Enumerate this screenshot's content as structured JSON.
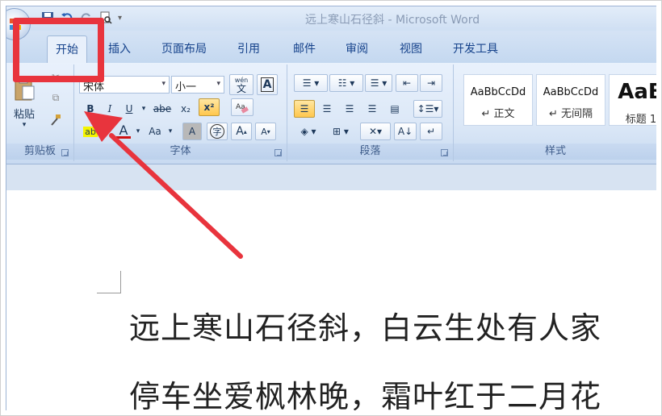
{
  "window": {
    "title": "远上寒山石径斜 - Microsoft Word"
  },
  "tabs": [
    "开始",
    "插入",
    "页面布局",
    "引用",
    "邮件",
    "审阅",
    "视图",
    "开发工具"
  ],
  "clipboard": {
    "paste_label": "粘贴",
    "group_label": "剪贴板"
  },
  "font": {
    "font_name": "宋体",
    "font_size": "小一",
    "group_label": "字体",
    "phonetic_label": "wén",
    "phonetic_char": "文",
    "bold": "B",
    "italic": "I",
    "underline": "U",
    "strike": "abe",
    "subscript": "x₂",
    "superscript": "x²",
    "highlight": "ab",
    "font_color": "A",
    "change_case": "Aa",
    "char_shading": "A",
    "enclose": "字",
    "grow": "A",
    "shrink": "A"
  },
  "paragraph": {
    "group_label": "段落"
  },
  "styles": {
    "group_label": "样式",
    "items": [
      {
        "sample": "AaBbCcDd",
        "name": "↵ 正文"
      },
      {
        "sample": "AaBbCcDd",
        "name": "↵ 无间隔"
      },
      {
        "sample": "AaB",
        "name": "标题 1"
      }
    ]
  },
  "document": {
    "lines": [
      "远上寒山石径斜，白云生处有人家",
      "停车坐爱枫林晚，霜叶红于二月花"
    ]
  },
  "colors": {
    "annotation": "#e8343d",
    "highlight_yellow": "#f5f500",
    "font_red": "#d01010"
  }
}
